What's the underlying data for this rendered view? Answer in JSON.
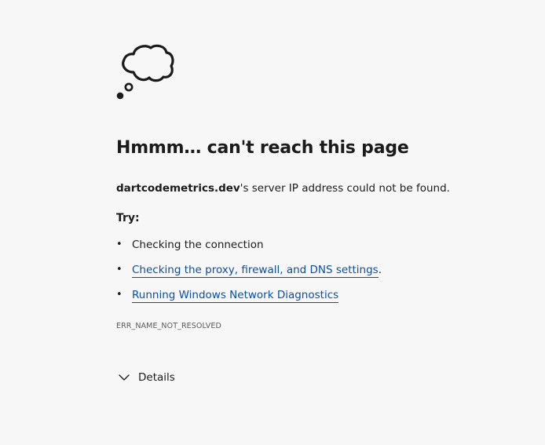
{
  "page": {
    "heading": "Hmmm… can't reach this page",
    "message": {
      "domain": "dartcodemetrics.dev",
      "rest": "'s server IP address could not be found."
    },
    "try_label": "Try:",
    "suggestions": [
      {
        "text": "Checking the connection",
        "is_link": false,
        "suffix": ""
      },
      {
        "text": "Checking the proxy, firewall, and DNS settings",
        "is_link": true,
        "suffix": "."
      },
      {
        "text": "Running Windows Network Diagnostics",
        "is_link": true,
        "suffix": ""
      }
    ],
    "bullet": "•",
    "error_code": "ERR_NAME_NOT_RESOLVED",
    "details_label": "Details"
  },
  "icons": {
    "illustration": "thought-cloud-icon",
    "details_toggle": "chevron-down-icon"
  },
  "colors": {
    "background": "#f7f7f7",
    "text": "#1b1b1b",
    "link": "#0b4fa0",
    "muted": "#5a5a5a"
  }
}
